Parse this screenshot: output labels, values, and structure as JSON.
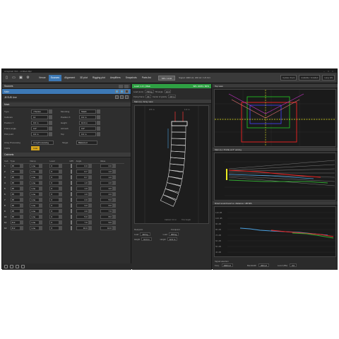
{
  "window": {
    "title": "ArrayCalc V10 – untitled.dbpr"
  },
  "toolbar": {
    "tabs": [
      "Venue",
      "Sources",
      "Alignment",
      "3D plot",
      "Rigging plot",
      "Amplifiers",
      "Snapshots",
      "Parts list"
    ],
    "active_tab": 1,
    "button": "SPL / Limit",
    "signal": "Signal: 4000 Hz, 200 Hz / 1/3 Oct",
    "right_labels": [
      "Update check",
      "Available / Installed",
      "Lang: EN"
    ]
  },
  "sources": {
    "header": "Sources",
    "items": [
      {
        "label": "Main"
      },
      {
        "label": "J8 SUB Line"
      }
    ],
    "main_header": "Main",
    "fields": [
      {
        "label": "Type",
        "value": "J Series",
        "label2": "Mounting",
        "value2": "Stack"
      },
      {
        "label": "Cabinets",
        "value": "12",
        "label2": "Position X",
        "value2": "0.0 m"
      },
      {
        "label": "Position Y",
        "value": "0.0 m",
        "label2": "Height",
        "value2": "10.0 m"
      },
      {
        "label": "Frame angle",
        "value": "0.0°",
        "label2": "Azimuth",
        "value2": "0.0°"
      },
      {
        "label": "Pick point",
        "value": "0.0 m",
        "label2": "Top",
        "value2": "0.0 m"
      }
    ],
    "processing_label": "Array Processing",
    "processing_value": "ArrayProcessing",
    "target_label": "Target",
    "target_value": "Balanced",
    "toggle_label": "TOPS",
    "toggle_value": "CAE",
    "cabinets_header": "Cabinets",
    "columns": [
      "Cab",
      "Type",
      "Damp",
      "Level",
      "HPF",
      "Angle",
      "Value"
    ],
    "rows": [
      [
        "1",
        "J8",
        "Line",
        "0",
        "",
        "0.0",
        "0.0"
      ],
      [
        "2",
        "J8",
        "Line",
        "0",
        "",
        "0.7",
        "1.0"
      ],
      [
        "3",
        "J8",
        "Line",
        "0",
        "",
        "0.7",
        "1.0"
      ],
      [
        "4",
        "J8",
        "Line",
        "0",
        "",
        "1.0",
        "2.0"
      ],
      [
        "5",
        "J8",
        "Line",
        "0",
        "",
        "1.0",
        "3.0"
      ],
      [
        "6",
        "J8",
        "Line",
        "0",
        "",
        "1.0",
        "4.0"
      ],
      [
        "7",
        "J8",
        "Line",
        "0",
        "",
        "2.0",
        "5.0"
      ],
      [
        "8",
        "J8",
        "Line",
        "0",
        "",
        "3.0",
        "6.0"
      ],
      [
        "9",
        "J8",
        "Line",
        "0",
        "",
        "4.0",
        "7.0"
      ],
      [
        "10",
        "J8",
        "Line",
        "0",
        "",
        "5.0",
        "8.0"
      ],
      [
        "11",
        "J12",
        "Line",
        "0",
        "",
        "7.0",
        "9.0"
      ],
      [
        "12",
        "J12",
        "Line",
        "0",
        "",
        "10.0",
        "10.0"
      ]
    ]
  },
  "summary": {
    "bar": "Load: 1.3 t  |  Main",
    "bar_right": "SPL 100% / 80%",
    "rows": [
      {
        "label": "Load (sum)",
        "value": "700 kg",
        "label2": "Tilt angle",
        "value2": "12.0"
      },
      {
        "label": "Flying frame",
        "value": "FF",
        "label2": "Center of gravity",
        "value2": "0.8 m"
      }
    ]
  },
  "array_view": {
    "title": "Main (L): Array view",
    "scale_labels": [
      "0.5 m",
      "1.0 m"
    ],
    "lower_labels": [
      "Cabinet: 0.0 m",
      "Trim height"
    ]
  },
  "center_bottom": {
    "section1": "Rearpoint",
    "section2": "Frontpoint",
    "load1_label": "Load",
    "load1_value": "410 kg",
    "load2_label": "Load",
    "load2_value": "290 kg",
    "h1_label": "Height",
    "h1_value": "12.0 m",
    "h2_label": "Height",
    "h2_value": "12.0 m"
  },
  "plots": {
    "top": "Top view",
    "profile": "Main (L): Profile at 0° aiming",
    "spl": "Direct sound level vs. distance / dB SPL",
    "ylabels": [
      "110 dB",
      "100 dB",
      "90 dB",
      "80 dB",
      "70 dB",
      "60 dB",
      "50 dB",
      "40 dB"
    ]
  },
  "signal_selection": {
    "title": "Signal selection",
    "freq_label": "Freq.",
    "freq_value": "4000 Hz",
    "bw_label": "Bandwidth",
    "bw_value": "200 Hz",
    "level_label": "Level (dBu)",
    "level_value": "0.0"
  },
  "colors": {
    "accent": "#3d79b6",
    "status_green": "#2ea043",
    "warning": "#d6a51c"
  }
}
